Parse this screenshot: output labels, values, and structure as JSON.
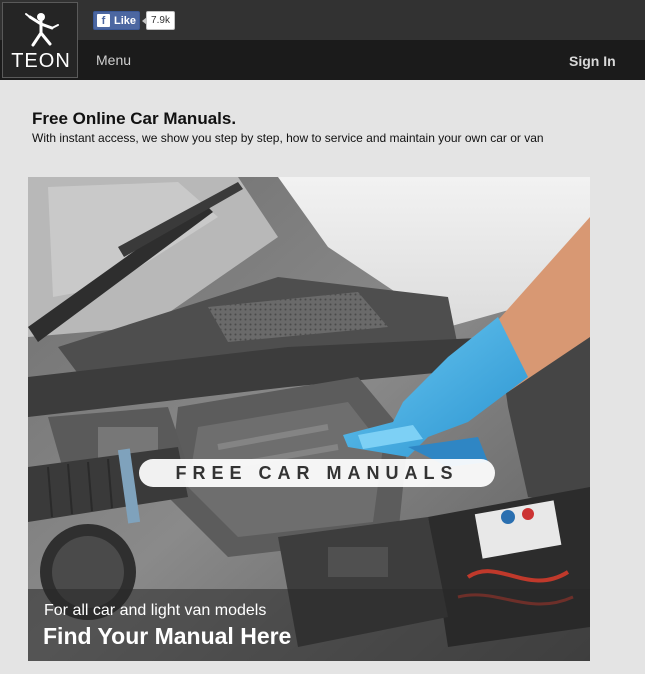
{
  "header": {
    "brand": "TEON",
    "facebook": {
      "like_label": "Like",
      "like_count": "7.9k"
    },
    "menu_label": "Menu",
    "signin_label": "Sign In"
  },
  "main": {
    "headline": "Free Online Car Manuals.",
    "subline": "With instant access, we show you step by step, how to service and maintain your own car or van",
    "hero": {
      "banner_text": "FREE CAR MANUALS",
      "caption_line1": "For all car and light van models",
      "caption_line2": "Find Your Manual Here"
    }
  },
  "colors": {
    "topbar": "#323232",
    "navbar": "#1b1b1b",
    "page_bg": "#e4e4e4",
    "facebook_blue": "#4c67a1",
    "glove_blue": "#3fb0e8"
  },
  "icons": {
    "logo": "mechanic-figure-icon",
    "facebook": "facebook-f-icon"
  }
}
